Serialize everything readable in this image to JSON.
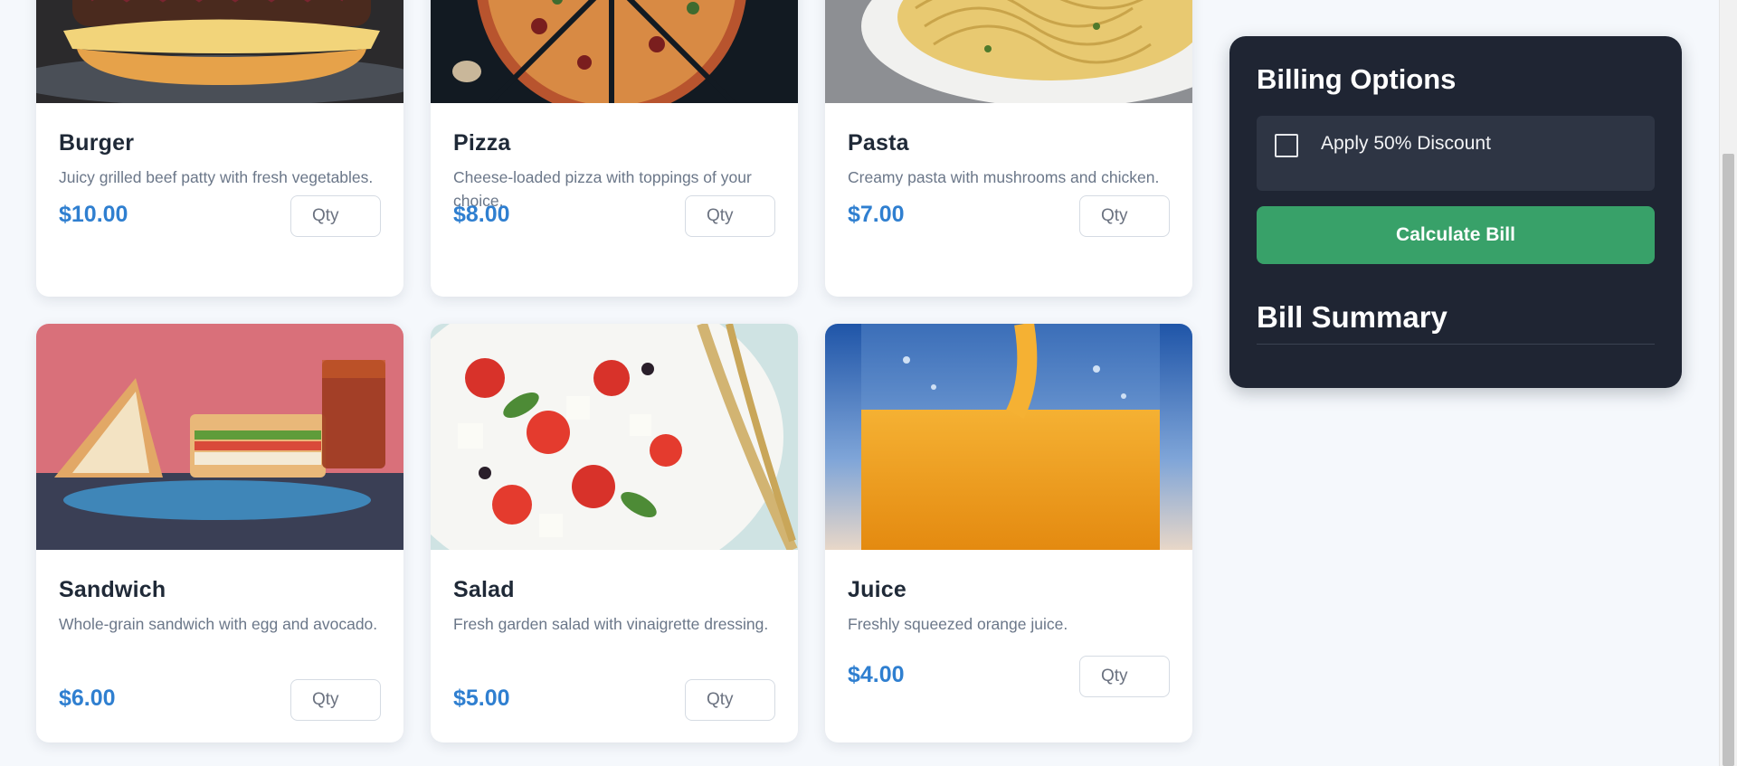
{
  "menu": {
    "items": [
      {
        "name": "Burger",
        "description": "Juicy grilled beef patty with fresh vegetables.",
        "price": "$10.00",
        "qty_placeholder": "Qty"
      },
      {
        "name": "Pizza",
        "description": "Cheese-loaded pizza with toppings of your choice.",
        "price": "$8.00",
        "qty_placeholder": "Qty"
      },
      {
        "name": "Pasta",
        "description": "Creamy pasta with mushrooms and chicken.",
        "price": "$7.00",
        "qty_placeholder": "Qty"
      },
      {
        "name": "Sandwich",
        "description": "Whole-grain sandwich with egg and avocado.",
        "price": "$6.00",
        "qty_placeholder": "Qty"
      },
      {
        "name": "Salad",
        "description": "Fresh garden salad with vinaigrette dressing.",
        "price": "$5.00",
        "qty_placeholder": "Qty"
      },
      {
        "name": "Juice",
        "description": "Freshly squeezed orange juice.",
        "price": "$4.00",
        "qty_placeholder": "Qty"
      }
    ]
  },
  "billing": {
    "title": "Billing Options",
    "discount_label": "Apply 50% Discount",
    "discount_checked": false,
    "calculate_label": "Calculate Bill",
    "summary_title": "Bill Summary"
  },
  "colors": {
    "accent_price": "#2f7fd0",
    "panel_bg": "#1f2533",
    "calc_button": "#38a169"
  }
}
